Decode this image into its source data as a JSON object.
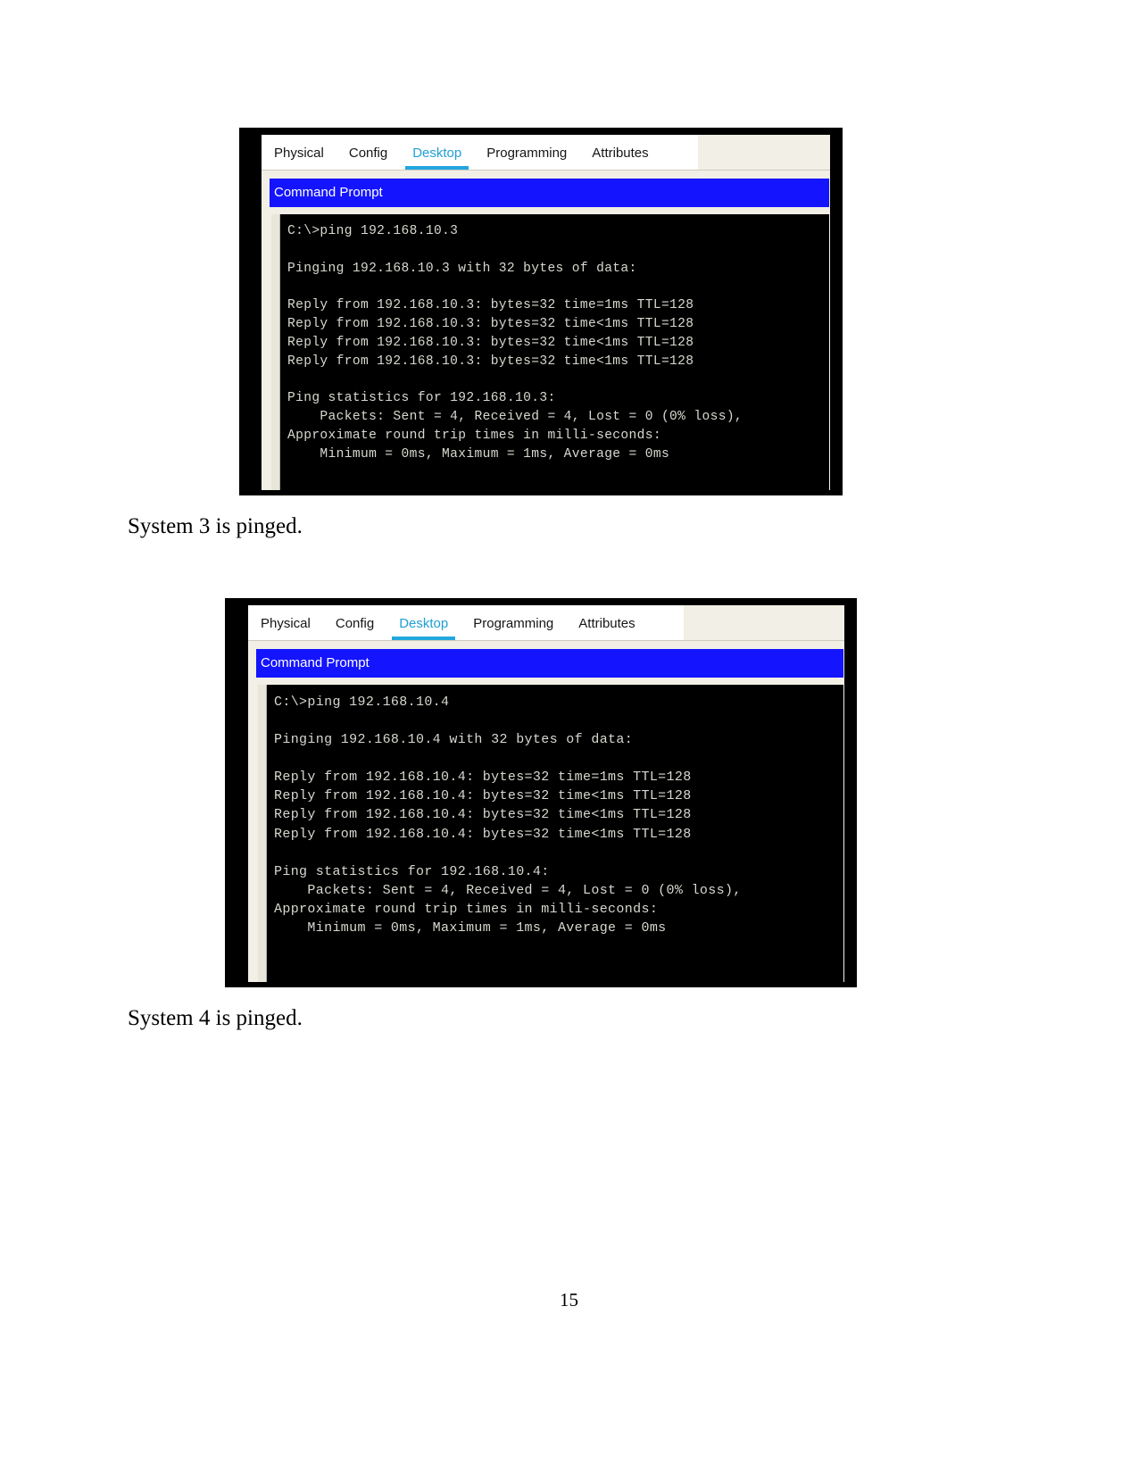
{
  "document": {
    "page_number": "15",
    "captions": [
      "System 3 is pinged.",
      "System 4 is pinged."
    ]
  },
  "figures": [
    {
      "id": "figure-1",
      "tabs": [
        {
          "label": "Physical",
          "active": false
        },
        {
          "label": "Config",
          "active": false
        },
        {
          "label": "Desktop",
          "active": true
        },
        {
          "label": "Programming",
          "active": false
        },
        {
          "label": "Attributes",
          "active": false
        }
      ],
      "command_prompt": {
        "title": "Command Prompt",
        "lines": [
          "C:\\>ping 192.168.10.3",
          "",
          "Pinging 192.168.10.3 with 32 bytes of data:",
          "",
          "Reply from 192.168.10.3: bytes=32 time=1ms TTL=128",
          "Reply from 192.168.10.3: bytes=32 time<1ms TTL=128",
          "Reply from 192.168.10.3: bytes=32 time<1ms TTL=128",
          "Reply from 192.168.10.3: bytes=32 time<1ms TTL=128",
          "",
          "Ping statistics for 192.168.10.3:",
          "    Packets: Sent = 4, Received = 4, Lost = 0 (0% loss),",
          "Approximate round trip times in milli-seconds:",
          "    Minimum = 0ms, Maximum = 1ms, Average = 0ms"
        ]
      }
    },
    {
      "id": "figure-2",
      "tabs": [
        {
          "label": "Physical",
          "active": false
        },
        {
          "label": "Config",
          "active": false
        },
        {
          "label": "Desktop",
          "active": true
        },
        {
          "label": "Programming",
          "active": false
        },
        {
          "label": "Attributes",
          "active": false
        }
      ],
      "command_prompt": {
        "title": "Command Prompt",
        "lines": [
          "C:\\>ping 192.168.10.4",
          "",
          "Pinging 192.168.10.4 with 32 bytes of data:",
          "",
          "Reply from 192.168.10.4: bytes=32 time=1ms TTL=128",
          "Reply from 192.168.10.4: bytes=32 time<1ms TTL=128",
          "Reply from 192.168.10.4: bytes=32 time<1ms TTL=128",
          "Reply from 192.168.10.4: bytes=32 time<1ms TTL=128",
          "",
          "Ping statistics for 192.168.10.4:",
          "    Packets: Sent = 4, Received = 4, Lost = 0 (0% loss),",
          "Approximate round trip times in milli-seconds:",
          "    Minimum = 0ms, Maximum = 1ms, Average = 0ms"
        ]
      }
    }
  ],
  "colors": {
    "active_tab": "#22a7df",
    "title_bar": "#1414ff",
    "terminal_bg": "#000000",
    "window_bg": "#f1efe6"
  }
}
